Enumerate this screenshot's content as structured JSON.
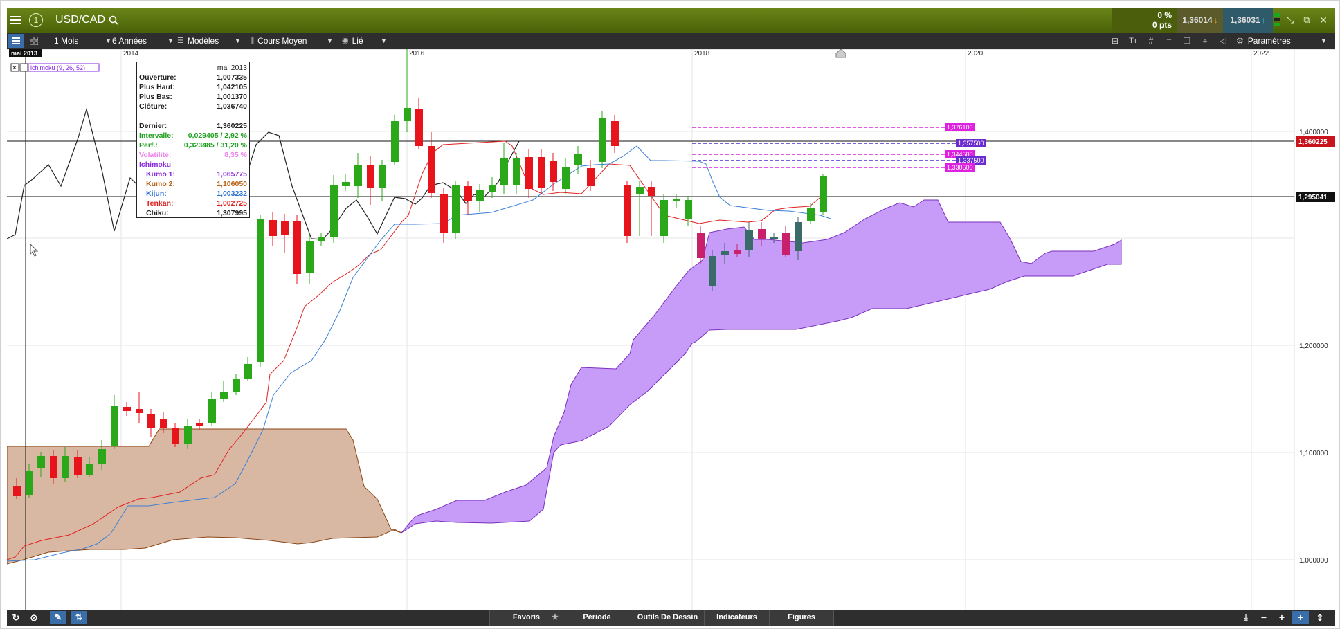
{
  "header": {
    "symbol": "USD/CAD",
    "change_pct": "0 %",
    "change_pts": "0 pts",
    "bid": "1,36014",
    "ask": "1,36031",
    "colors": {
      "bar": "#5a7310",
      "bid_bg": "#5a5a2a",
      "ask_bg": "#2f5a6a"
    }
  },
  "toolbar": {
    "period": "1 Mois",
    "range": "6 Années",
    "templates": "Modèles",
    "price_type": "Cours Moyen",
    "link": "Lié",
    "settings": "Paramètres"
  },
  "chart": {
    "cursor_date": "mai 2013",
    "indicator_label": "ichimoku (9, 26, 52)",
    "year_labels": [
      "2014",
      "2016",
      "2018",
      "2020",
      "2022"
    ],
    "price_labels": [
      "1,400000",
      "1,200000",
      "1,100000",
      "1,000000"
    ],
    "last_price_tag": "1,360225",
    "crosshair_tag": "1,295041",
    "level_tags": [
      "1,376100",
      "1,357500",
      "1,344500",
      "1,337500",
      "1,330500"
    ],
    "colors": {
      "up": "#2aa81a",
      "down": "#e8141c",
      "tenkan": "#e02020",
      "kijun": "#3a7fd5",
      "chiku": "#222222",
      "kumo_bull": "#c79bf8",
      "kumo_bear": "#d9b8a3",
      "level": "#e020e0"
    }
  },
  "info": {
    "date": "mai 2013",
    "rows": [
      {
        "label": "Ouverture:",
        "value": "1,007335",
        "color": "#222"
      },
      {
        "label": "Plus Haut:",
        "value": "1,042105",
        "color": "#222"
      },
      {
        "label": "Plus Bas:",
        "value": "1,001370",
        "color": "#222"
      },
      {
        "label": "Clôture:",
        "value": "1,036740",
        "color": "#222"
      },
      {
        "label": "Dernier:",
        "value": "1,360225",
        "color": "#222"
      },
      {
        "label": "Intervalle:",
        "value": "0,029405 / 2,92 %",
        "color": "#1ea01e"
      },
      {
        "label": "Perf.:",
        "value": "0,323485 / 31,20 %",
        "color": "#1ea01e"
      },
      {
        "label": "Volatilité:",
        "value": "8,35 %",
        "color": "#ee82ee"
      },
      {
        "label": "Ichimoku",
        "value": "",
        "color": "#8a2be2"
      },
      {
        "label": "Kumo 1:",
        "value": "1,065775",
        "color": "#8a2be2"
      },
      {
        "label": "Kumo 2:",
        "value": "1,106050",
        "color": "#b8651a"
      },
      {
        "label": "Kijun:",
        "value": "1,003232",
        "color": "#2a6fd5"
      },
      {
        "label": "Tenkan:",
        "value": "1,002725",
        "color": "#e02020"
      },
      {
        "label": "Chiku:",
        "value": "1,307995",
        "color": "#222"
      }
    ]
  },
  "footer": {
    "favorites": "Favoris",
    "period": "Période",
    "drawing_tools": "Outils De Dessin",
    "indicators": "Indicateurs",
    "figures": "Figures"
  }
}
